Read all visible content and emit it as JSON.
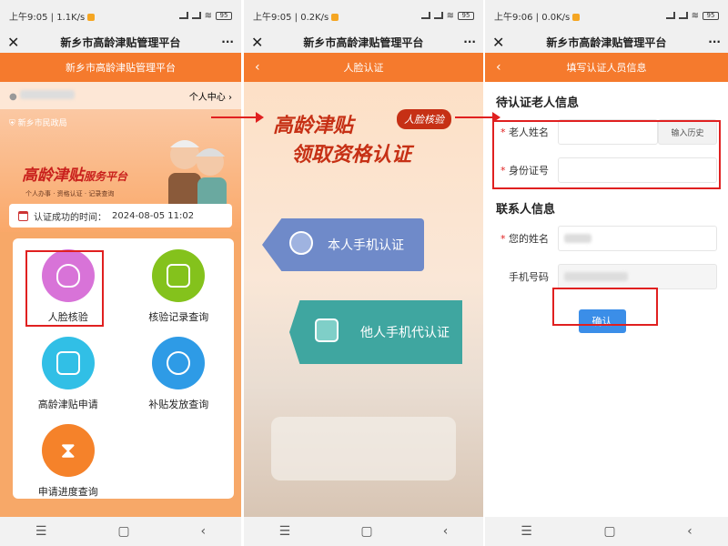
{
  "screens": [
    {
      "status": {
        "time": "上午9:05",
        "speed": "1.1K/s",
        "battery": "95"
      },
      "title": "新乡市高龄津贴管理平台",
      "more": "···",
      "header": "新乡市高龄津贴管理平台",
      "user_center": "个人中心",
      "org": "新乡市民政局",
      "banner_title": "高龄津贴",
      "banner_title_suffix": "服务平台",
      "banner_sub": "个人办事 · 资格认证 · 记录查询",
      "auth_label": "认证成功的时间：",
      "auth_time": "2024-08-05 11:02",
      "menu": [
        {
          "label": "人脸核验",
          "color": "#d873d8"
        },
        {
          "label": "核验记录查询",
          "color": "#84c21c"
        },
        {
          "label": "高龄津贴申请",
          "color": "#31bfe6"
        },
        {
          "label": "补贴发放查询",
          "color": "#2e9be6"
        },
        {
          "label": "申请进度查询",
          "color": "#f5822a"
        }
      ]
    },
    {
      "status": {
        "time": "上午9:05",
        "speed": "0.2K/s",
        "battery": "95"
      },
      "title": "新乡市高龄津贴管理平台",
      "more": "···",
      "header": "人脸认证",
      "headline1": "高龄津贴",
      "headline2": "领取资格认证",
      "tag": "人脸核验",
      "option_self": "本人手机认证",
      "option_other": "他人手机代认证"
    },
    {
      "status": {
        "time": "上午9:06",
        "speed": "0.0K/s",
        "battery": "95"
      },
      "title": "新乡市高龄津贴管理平台",
      "more": "···",
      "header": "填写认证人员信息",
      "section_elder": "待认证老人信息",
      "elder_name_label": "老人姓名",
      "history_button": "输入历史",
      "id_label": "身份证号",
      "section_contact": "联系人信息",
      "contact_name_label": "您的姓名",
      "phone_label": "手机号码",
      "confirm": "确认"
    }
  ],
  "nav": {
    "menu": "☰",
    "home": "▢",
    "back": "‹"
  },
  "colors": {
    "orange": "#f57a2d",
    "red_highlight": "#e02020",
    "confirm_blue": "#3b8ee8"
  }
}
